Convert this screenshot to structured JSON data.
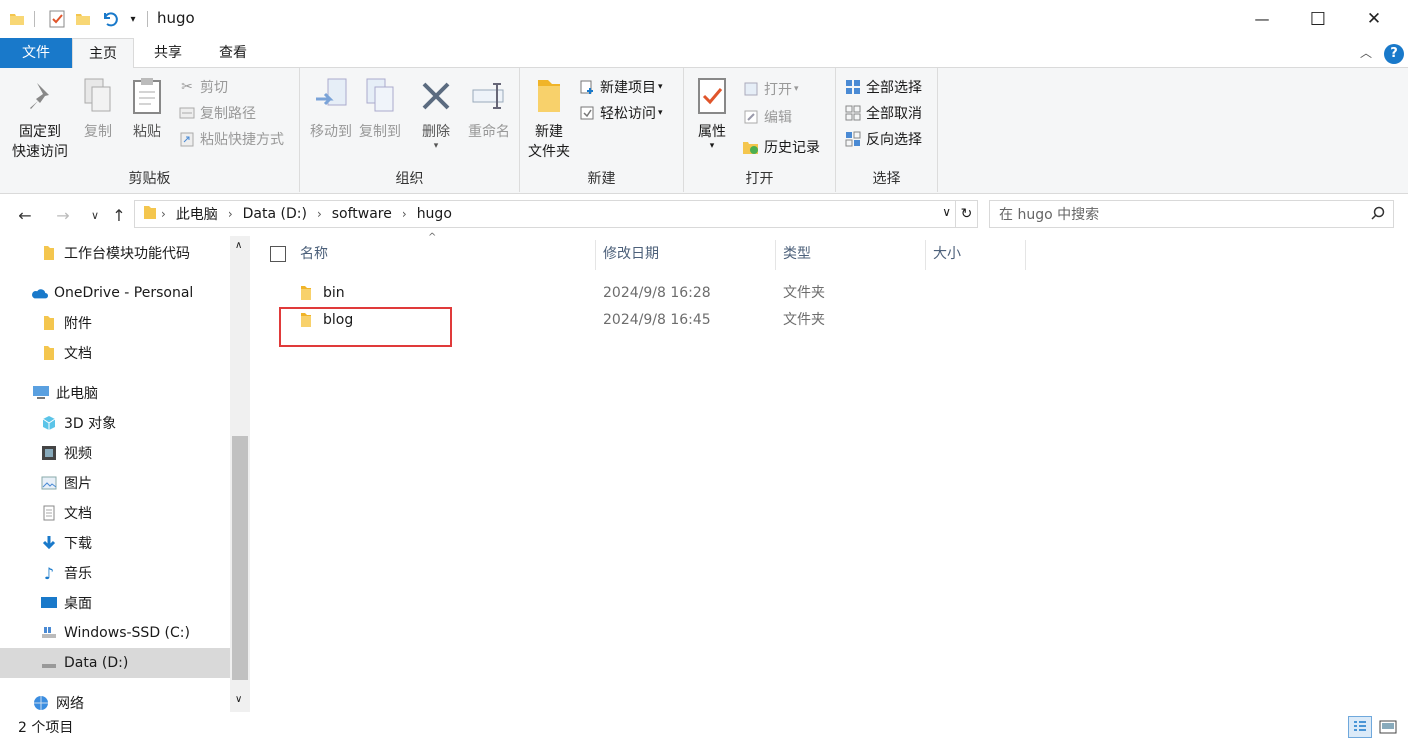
{
  "window": {
    "title": "hugo",
    "controls": {
      "minimize": "—",
      "maximize": "☐",
      "close": "✕"
    }
  },
  "tabs": [
    {
      "label": "文件"
    },
    {
      "label": "主页"
    },
    {
      "label": "共享"
    },
    {
      "label": "查看"
    }
  ],
  "ribbon": {
    "clipboard": {
      "label": "剪贴板",
      "pin_line1": "固定到",
      "pin_line2": "快速访问",
      "copy": "复制",
      "paste": "粘贴",
      "cut": "剪切",
      "copy_path": "复制路径",
      "paste_shortcut": "粘贴快捷方式"
    },
    "organize": {
      "label": "组织",
      "move_to": "移动到",
      "copy_to": "复制到",
      "delete": "删除",
      "rename": "重命名"
    },
    "new": {
      "label": "新建",
      "new_folder_line1": "新建",
      "new_folder_line2": "文件夹",
      "new_item": "新建项目",
      "easy_access": "轻松访问"
    },
    "open": {
      "label": "打开",
      "properties": "属性",
      "open": "打开",
      "edit": "编辑",
      "history": "历史记录"
    },
    "select": {
      "label": "选择",
      "select_all": "全部选择",
      "select_none": "全部取消",
      "invert": "反向选择"
    }
  },
  "address": {
    "crumbs": [
      "此电脑",
      "Data (D:)",
      "software",
      "hugo"
    ],
    "search_placeholder": "在 hugo 中搜索"
  },
  "nav": {
    "items": [
      {
        "label": "工作台模块功能代码",
        "icon": "folder-icon"
      },
      {
        "label": "OneDrive - Personal",
        "icon": "cloud-icon"
      },
      {
        "label": "附件",
        "icon": "folder-icon"
      },
      {
        "label": "文档",
        "icon": "folder-icon"
      },
      {
        "label": "此电脑",
        "icon": "computer-icon"
      },
      {
        "label": "3D 对象",
        "icon": "cube-icon"
      },
      {
        "label": "视频",
        "icon": "video-icon"
      },
      {
        "label": "图片",
        "icon": "picture-icon"
      },
      {
        "label": "文档",
        "icon": "document-icon"
      },
      {
        "label": "下载",
        "icon": "download-icon"
      },
      {
        "label": "音乐",
        "icon": "music-icon"
      },
      {
        "label": "桌面",
        "icon": "desktop-icon"
      },
      {
        "label": "Windows-SSD (C:)",
        "icon": "drive-icon"
      },
      {
        "label": "Data (D:)",
        "icon": "drive-icon"
      },
      {
        "label": "网络",
        "icon": "network-icon"
      }
    ]
  },
  "list": {
    "columns": {
      "name": "名称",
      "modified": "修改日期",
      "type": "类型",
      "size": "大小"
    },
    "rows": [
      {
        "name": "bin",
        "modified": "2024/9/8 16:28",
        "type": "文件夹",
        "size": ""
      },
      {
        "name": "blog",
        "modified": "2024/9/8 16:45",
        "type": "文件夹",
        "size": ""
      }
    ]
  },
  "status": {
    "item_count": "2 个项目"
  },
  "colors": {
    "accent": "#1979ca",
    "highlight_box": "#e03a3a",
    "folder": "#f4c64e"
  }
}
